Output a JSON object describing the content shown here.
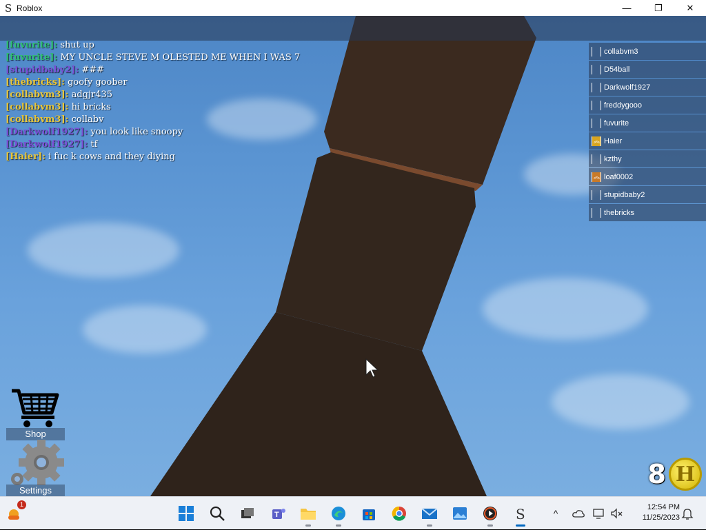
{
  "window": {
    "title": "Roblox",
    "app_icon": "S",
    "minimize_label": "—",
    "maximize_label": "❐",
    "close_label": "✕"
  },
  "chat": [
    {
      "who": "[fuvurite]:",
      "msg": "shut up",
      "color": "#2fbf71"
    },
    {
      "who": "[fuvurite]:",
      "msg": "MY UNCLE STEVE M OLESTED ME WHEN I WAS 7",
      "color": "#2fbf71"
    },
    {
      "who": "[stupidbaby2]:",
      "msg": "###",
      "color": "#7b4fd6"
    },
    {
      "who": "[thebricks]:",
      "msg": "goofy goober",
      "color": "#e8c63a"
    },
    {
      "who": "[collabvm3]:",
      "msg": "adgjr435",
      "color": "#e8c63a"
    },
    {
      "who": "[collabvm3]:",
      "msg": "hi bricks",
      "color": "#e8c63a"
    },
    {
      "who": "[collabvm3]:",
      "msg": "collabv",
      "color": "#e8c63a"
    },
    {
      "who": "[Darkwolf1927]:",
      "msg": "you look like snoopy",
      "color": "#7b4fd6"
    },
    {
      "who": "[Darkwolf1927]:",
      "msg": "tf",
      "color": "#7b4fd6"
    },
    {
      "who": "[Haier]:",
      "msg": "i fuc k cows and they diying",
      "color": "#e8c63a"
    }
  ],
  "players": [
    {
      "name": "collabvm3",
      "icon": "bracket"
    },
    {
      "name": "D54ball",
      "icon": "bracket"
    },
    {
      "name": "Darkwolf1927",
      "icon": "bracket"
    },
    {
      "name": "freddygooo",
      "icon": "bracket"
    },
    {
      "name": "fuvurite",
      "icon": "bracket"
    },
    {
      "name": "Haier",
      "icon": "gold-rank"
    },
    {
      "name": "kzthy",
      "icon": "bracket"
    },
    {
      "name": "loaf0002",
      "icon": "orange-rank"
    },
    {
      "name": "stupidbaby2",
      "icon": "bracket"
    },
    {
      "name": "thebricks",
      "icon": "bracket"
    }
  ],
  "hud": {
    "shop_label": "Shop",
    "settings_label": "Settings",
    "coin_count": "8",
    "coin_letter": "H"
  },
  "taskbar": {
    "widgets_badge": "1",
    "time": "12:54 PM",
    "date": "11/25/2023"
  }
}
